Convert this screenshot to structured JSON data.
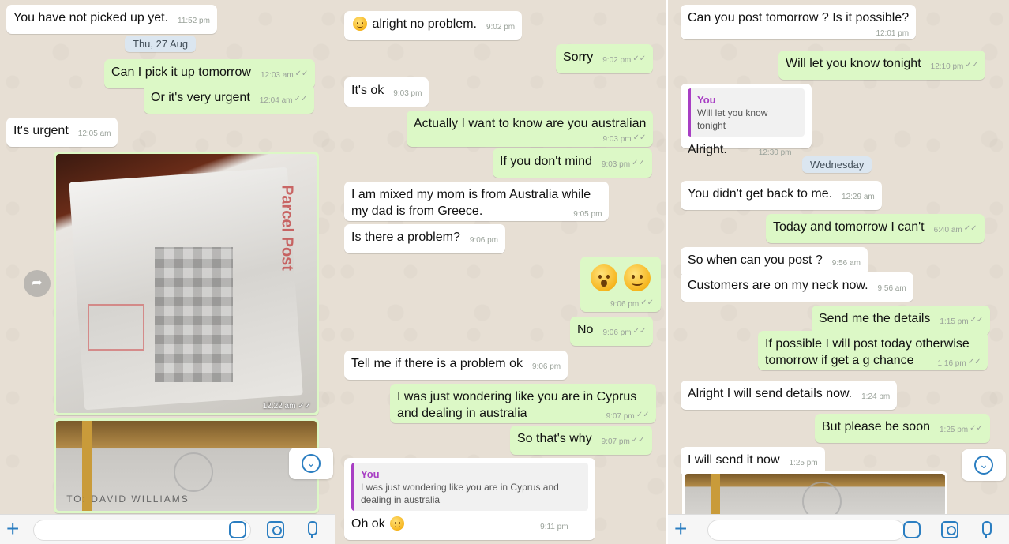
{
  "panel1": {
    "messages": [
      {
        "text": "You have not picked up yet.",
        "time": "11:52 pm"
      },
      {
        "text": "Can I pick it up tomorrow",
        "time": "12:03 am"
      },
      {
        "text": "Or it's very urgent",
        "time": "12:04 am"
      },
      {
        "text": "It's urgent",
        "time": "12:05 am"
      }
    ],
    "date_label": "Thu, 27 Aug",
    "image_time": "12:22 am",
    "image_label": "Parcel Post",
    "photo_handwriting": "TO: DAVID WILLIAMS"
  },
  "panel2": {
    "messages": [
      {
        "text": "alright no problem.",
        "time": "9:02 pm"
      },
      {
        "text": "Sorry",
        "time": "9:02 pm"
      },
      {
        "text": "It's ok",
        "time": "9:03 pm"
      },
      {
        "text": "Actually I want to know are you australian",
        "time": "9:03 pm"
      },
      {
        "text": "If you don't mind",
        "time": "9:03 pm"
      },
      {
        "line1": "I am mixed my mom is from Australia while",
        "line2": "my dad is from Greece.",
        "time": "9:05 pm"
      },
      {
        "text": "Is there a problem?",
        "time": "9:06 pm"
      },
      {
        "text": "",
        "time": "9:06 pm"
      },
      {
        "text": "No",
        "time": "9:06 pm"
      },
      {
        "text": "Tell me if there is a problem ok",
        "time": "9:06 pm"
      },
      {
        "line1": "I was just wondering like you are in Cyprus",
        "line2": "and dealing in australia",
        "time": "9:07 pm"
      },
      {
        "text": "So that's why",
        "time": "9:07 pm"
      },
      {
        "text": "Oh ok",
        "time": "9:11 pm"
      }
    ],
    "quote": {
      "author": "You",
      "line1": "I was just wondering like you are in Cyprus and",
      "line2": "dealing in australia"
    }
  },
  "panel3": {
    "messages": [
      {
        "text": "Can you post tomorrow ? Is it possible?",
        "time": "12:01 pm"
      },
      {
        "text": "Will let you know tonight",
        "time": "12:10 pm"
      },
      {
        "text": "Alright.",
        "time": "12:30 pm"
      },
      {
        "text": "You didn't get back to me.",
        "time": "12:29 am"
      },
      {
        "text": "Today and tomorrow I can't",
        "time": "6:40 am"
      },
      {
        "text": "So when can you post ?",
        "time": "9:56 am"
      },
      {
        "text": "Customers are on my neck now.",
        "time": "9:56 am"
      },
      {
        "text": "Send me the details",
        "time": "1:15 pm"
      },
      {
        "line1": "If possible I will post today otherwise",
        "line2": "tomorrow if get a g chance",
        "time": "1:16 pm"
      },
      {
        "text": "Alright I will send details now.",
        "time": "1:24 pm"
      },
      {
        "text": "But please be soon",
        "time": "1:25 pm"
      },
      {
        "text": "I will send it now",
        "time": "1:25 pm"
      }
    ],
    "quote": {
      "author": "You",
      "text": "Will let you know tonight"
    },
    "date_label": "Wednesday"
  },
  "colors": {
    "incoming": "#ffffff",
    "outgoing": "#dcf8c6",
    "accent": "#2b7ec1",
    "quote_bar": "#a83fc4"
  },
  "icons": [
    "plus-icon",
    "sticker-icon",
    "camera-icon",
    "mic-icon",
    "chevron-down-icon",
    "forward-icon",
    "double-check-icon"
  ]
}
